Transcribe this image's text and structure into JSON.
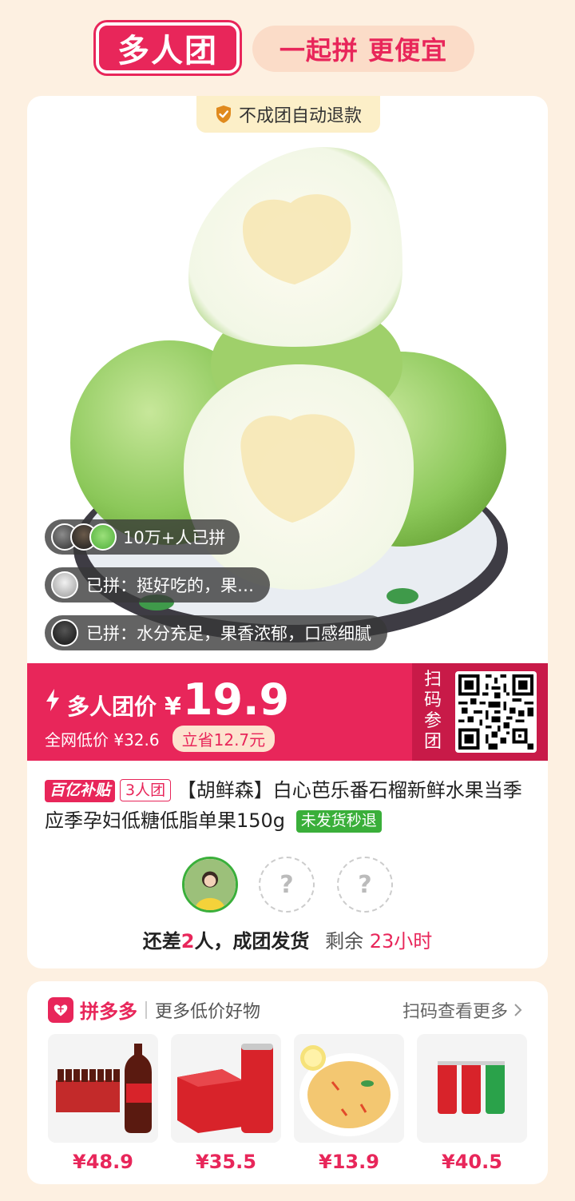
{
  "header": {
    "logo_text": "多人团",
    "slogan": "一起拼 更便宜"
  },
  "main": {
    "guarantee_text": "不成团自动退款",
    "bubbles": [
      {
        "text": "10万+人已拼"
      },
      {
        "text": "已拼：挺好吃的，果…"
      },
      {
        "text": "已拼：水分充足，果香浓郁，口感细腻"
      }
    ],
    "price": {
      "label": "多人团价",
      "currency": "¥",
      "value": "19.9",
      "lowest_text": "全网低价 ¥32.6",
      "save_text": "立省12.7元",
      "scan_label": "扫码参团"
    },
    "title": {
      "tag_subsidy": "百亿补贴",
      "tag_group": "3人团",
      "text": "【胡鲜森】白心芭乐番石榴新鲜水果当季应季孕妇低糖低脂单果150g",
      "tag_refund": "未发货秒退"
    },
    "slots": {
      "empty_mark": "?"
    },
    "status": {
      "prefix": "还差",
      "count": "2",
      "suffix": "人，成团发货",
      "remain_label": "剩余",
      "remain_time": "23小时"
    }
  },
  "more": {
    "brand": "拼多多",
    "subtitle": "更多低价好物",
    "link": "扫码查看更多",
    "goods": [
      {
        "price": "¥48.9"
      },
      {
        "price": "¥35.5"
      },
      {
        "price": "¥13.9"
      },
      {
        "price": "¥40.5"
      }
    ]
  },
  "colors": {
    "accent": "#e8265a",
    "background": "#fdf0e1",
    "success": "#3aaf3a"
  },
  "icons": [
    "shield-icon",
    "bolt-icon",
    "chevron-right-icon",
    "pinduoduo-logo-icon"
  ]
}
